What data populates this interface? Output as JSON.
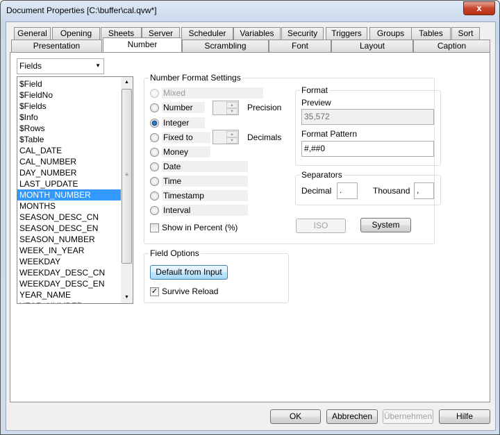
{
  "window": {
    "title": "Document Properties [C:\\buffer\\cal.qvw*]",
    "close": "x"
  },
  "tabs_row1": [
    "General",
    "Opening",
    "Sheets",
    "Server",
    "Scheduler",
    "Variables",
    "Security",
    "Triggers",
    "Groups",
    "Tables",
    "Sort"
  ],
  "tabs_row2": [
    "Presentation",
    "Number",
    "Scrambling",
    "Font",
    "Layout",
    "Caption"
  ],
  "active_tab": "Number",
  "fields_dropdown": {
    "value": "Fields"
  },
  "fields_list": {
    "items": [
      "$Field",
      "$FieldNo",
      "$Fields",
      "$Info",
      "$Rows",
      "$Table",
      "CAL_DATE",
      "CAL_NUMBER",
      "DAY_NUMBER",
      "LAST_UPDATE",
      "MONTH_NUMBER",
      "MONTHS",
      "SEASON_DESC_CN",
      "SEASON_DESC_EN",
      "SEASON_NUMBER",
      "WEEK_IN_YEAR",
      "WEEKDAY",
      "WEEKDAY_DESC_CN",
      "WEEKDAY_DESC_EN",
      "YEAR_NAME",
      "YEAR_NUMBER"
    ],
    "selected": "MONTH_NUMBER"
  },
  "number_format": {
    "legend": "Number Format Settings",
    "options": [
      "Mixed",
      "Number",
      "Integer",
      "Fixed to",
      "Money",
      "Date",
      "Time",
      "Timestamp",
      "Interval"
    ],
    "selected": "Integer",
    "disabled": [
      "Mixed"
    ],
    "precision_label": "Precision",
    "decimals_label": "Decimals",
    "show_percent": {
      "label": "Show in Percent (%)",
      "checked": false
    },
    "format": {
      "legend": "Format",
      "preview_label": "Preview",
      "preview_value": "35,572",
      "pattern_label": "Format Pattern",
      "pattern_value": "#,##0"
    },
    "separators": {
      "legend": "Separators",
      "decimal_label": "Decimal",
      "decimal_value": ".",
      "thousand_label": "Thousand",
      "thousand_value": ","
    },
    "iso_button": "ISO",
    "system_button": "System"
  },
  "field_options": {
    "legend": "Field Options",
    "default_button": "Default from Input",
    "survive_reload": {
      "label": "Survive Reload",
      "checked": true
    }
  },
  "footer": {
    "ok": "OK",
    "cancel": "Abbrechen",
    "apply": "Übernehmen",
    "help": "Hilfe"
  }
}
